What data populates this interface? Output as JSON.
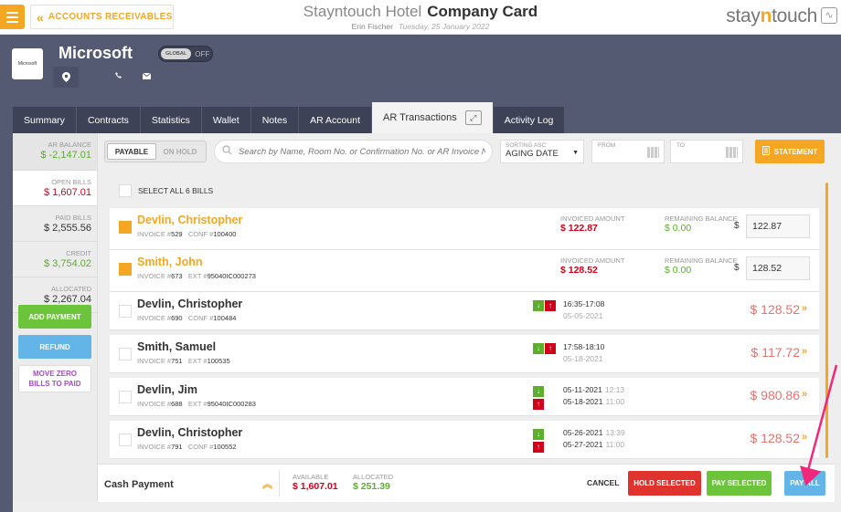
{
  "header": {
    "back_label": "ACCOUNTS RECEIVABLES",
    "hotel": "Stayntouch Hotel",
    "page_title": "Company Card",
    "user": "Erin Fischer",
    "date": "Tuesday, 25 January 2022",
    "logo_main": "stay",
    "logo_n": "n",
    "logo_rest": "touch"
  },
  "company": {
    "name": "Microsoft",
    "thumb_text": "Microsoft",
    "toggle_on": "GLOBAL",
    "toggle_off": "OFF"
  },
  "tabs": [
    "Summary",
    "Contracts",
    "Statistics",
    "Wallet",
    "Notes",
    "AR Account",
    "AR Transactions",
    "Activity Log"
  ],
  "sidebar": {
    "ar_balance_label": "AR BALANCE",
    "ar_balance": "$ -2,147.01",
    "open_label": "OPEN BILLS",
    "open": "$ 1,607.01",
    "paid_label": "PAID BILLS",
    "paid": "$ 2,555.56",
    "credit_label": "CREDIT",
    "credit": "$ 3,754.02",
    "allocated_label": "ALLOCATED",
    "allocated": "$ 2,267.04",
    "add_payment": "ADD PAYMENT",
    "refund": "REFUND",
    "move_zero_1": "MOVE ZERO",
    "move_zero_2": "BILLS TO PAID"
  },
  "filters": {
    "payable": "PAYABLE",
    "on_hold": "ON HOLD",
    "search_placeholder": "Search by Name, Room No. or Confirmation No. or AR Invoice N",
    "sort_label": "SORTING ASC",
    "sort_value": "AGING DATE",
    "from_label": "FROM",
    "to_label": "TO",
    "statement": "STATEMENT"
  },
  "select_all": "SELECT ALL 6 BILLS",
  "selected_rows": [
    {
      "name": "Devlin, Christopher",
      "invoice": "529",
      "ref_label": "CONF #",
      "ref": "100400",
      "invoiced_label": "INVOICED AMOUNT",
      "invoiced": "$ 122.87",
      "remaining_label": "REMAINING BALANCE",
      "remaining": "$ 0.00",
      "currency": "$",
      "amount": "122.87"
    },
    {
      "name": "Smith, John",
      "invoice": "673",
      "ref_label": "EXT #",
      "ref": "95040IC000273",
      "invoiced_label": "INVOICED AMOUNT",
      "invoiced": "$ 128.52",
      "remaining_label": "REMAINING BALANCE",
      "remaining": "$ 0.00",
      "currency": "$",
      "amount": "128.52"
    }
  ],
  "rows": [
    {
      "name": "Devlin, Christopher",
      "invoice": "690",
      "ref_label": "CONF #",
      "ref": "100484",
      "line1": "16:35-17:08",
      "line1_extra": "",
      "line2": "05-05-2021",
      "line2_extra": "",
      "balance": "$ 128.52"
    },
    {
      "name": "Smith, Samuel",
      "invoice": "751",
      "ref_label": "EXT #",
      "ref": "100535",
      "line1": "17:58-18:10",
      "line1_extra": "",
      "line2": "05-18-2021",
      "line2_extra": "",
      "balance": "$ 117.72"
    },
    {
      "name": "Devlin, Jim",
      "invoice": "688",
      "ref_label": "EXT #",
      "ref": "95040IC000283",
      "line1": "05-11-2021",
      "line1_extra": "12:13",
      "line2": "05-18-2021",
      "line2_extra": "11:00",
      "balance": "$ 980.86"
    },
    {
      "name": "Devlin, Christopher",
      "invoice": "791",
      "ref_label": "CONF #",
      "ref": "100552",
      "line1": "05-26-2021",
      "line1_extra": "13:39",
      "line2": "05-27-2021",
      "line2_extra": "11:00",
      "balance": "$ 128.52"
    }
  ],
  "invoice_label": "INVOICE #",
  "footer": {
    "payment_type": "Cash Payment",
    "available_label": "AVAILABLE",
    "available": "$ 1,607.01",
    "allocated_label": "ALLOCATED",
    "allocated": "$ 251.39",
    "cancel": "CANCEL",
    "hold_selected": "HOLD SELECTED",
    "pay_selected": "PAY SELECTED",
    "pay_all": "PAY ALL"
  },
  "colors": {
    "accent": "#f5a623",
    "slate": "#545a72",
    "green": "#6cc43b",
    "red": "#e0332d",
    "blue": "#63b5e8"
  }
}
